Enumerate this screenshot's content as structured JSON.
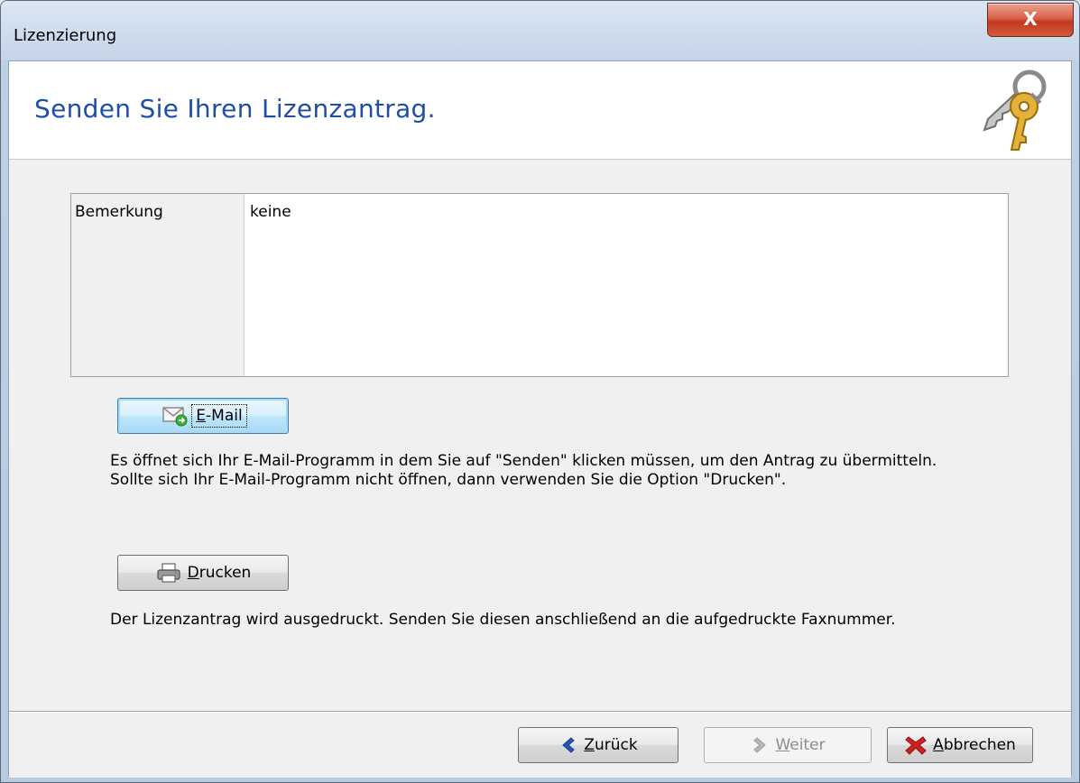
{
  "window": {
    "title": "Lizenzierung",
    "close_label": "X"
  },
  "header": {
    "title": "Senden Sie Ihren Lizenzantrag."
  },
  "remark": {
    "label": "Bemerkung",
    "value": "keine"
  },
  "email": {
    "button_mnemonic": "E",
    "button_rest": "-Mail",
    "description": "Es öffnet sich Ihr E-Mail-Programm in dem Sie auf \"Senden\" klicken müssen, um den Antrag zu übermitteln. Sollte sich Ihr E-Mail-Programm nicht öffnen, dann verwenden Sie die Option \"Drucken\"."
  },
  "print": {
    "button_mnemonic": "D",
    "button_rest": "rucken",
    "description": "Der Lizenzantrag wird ausgedruckt. Senden Sie diesen anschließend an die aufgedruckte Faxnummer."
  },
  "footer": {
    "back_mnemonic": "Z",
    "back_rest": "urück",
    "next_mnemonic": "W",
    "next_rest": "eiter",
    "cancel_mnemonic": "A",
    "cancel_rest": "bbrechen"
  },
  "colors": {
    "header_title": "#1f4fa6",
    "close_button": "#c2391f",
    "cancel_icon": "#d42020",
    "back_icon": "#2456b4"
  }
}
